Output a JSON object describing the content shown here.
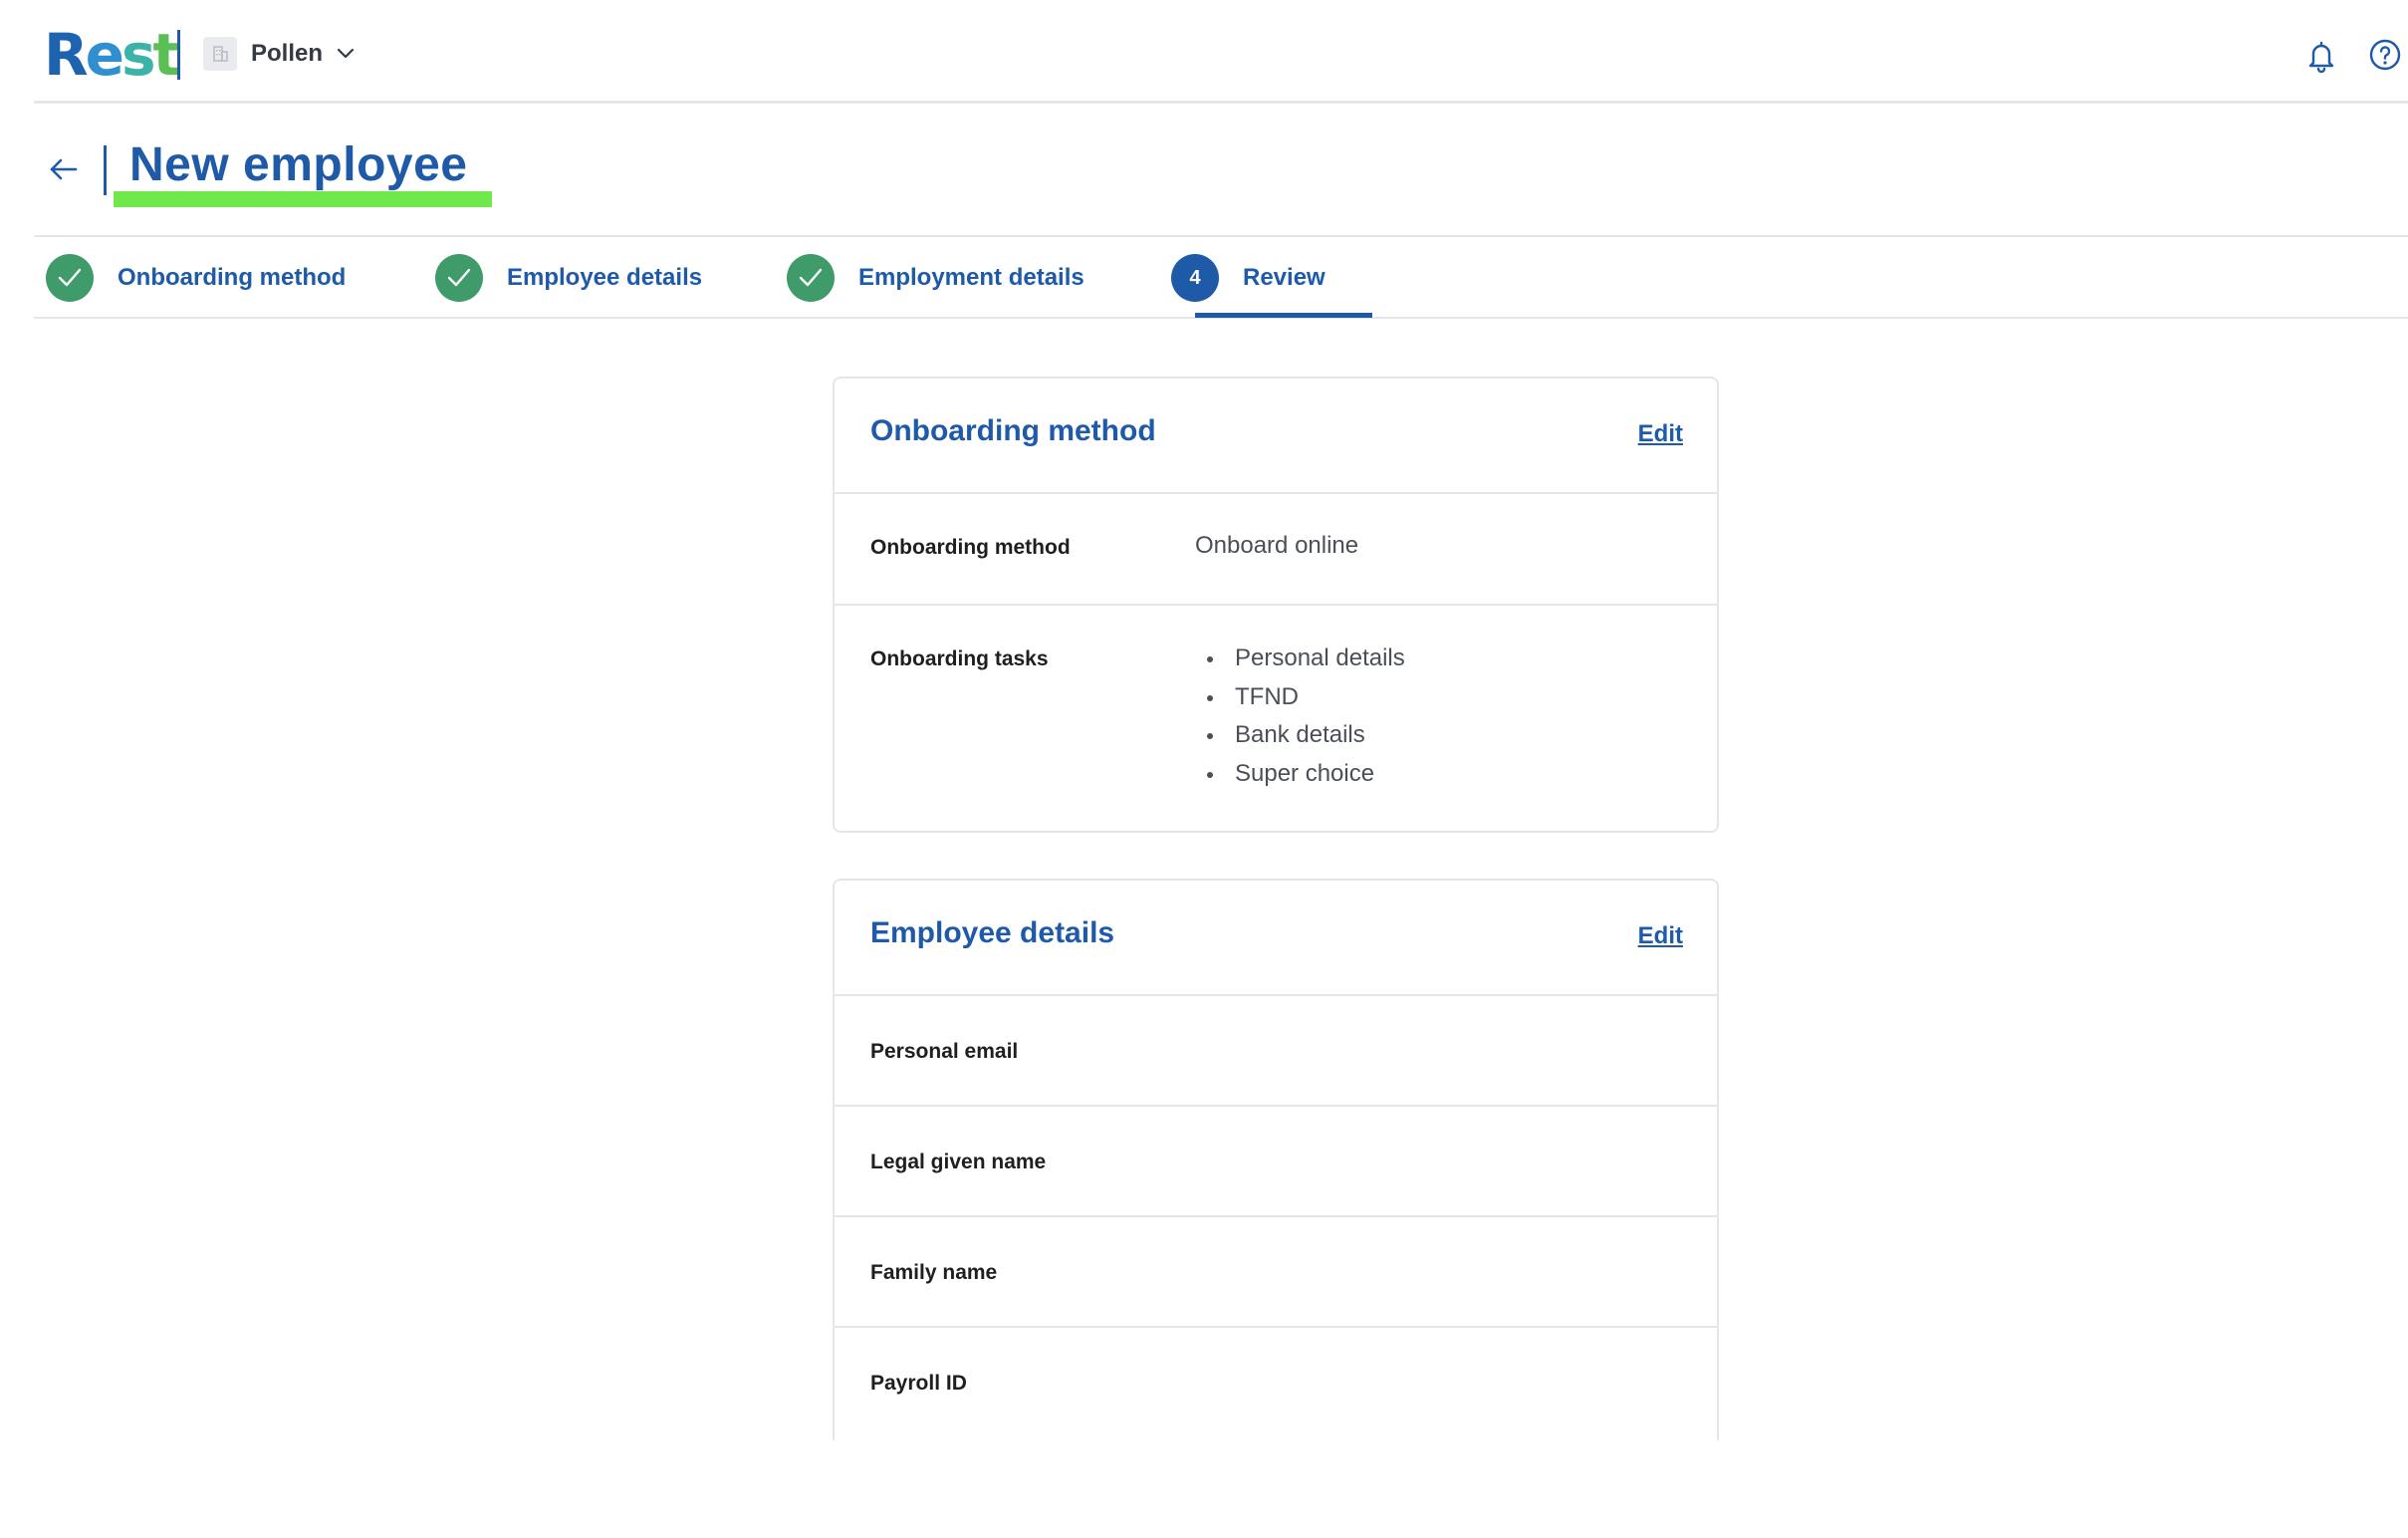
{
  "app": {
    "logo_letters": [
      "R",
      "e",
      "s",
      "t"
    ],
    "org_name": "Pollen"
  },
  "header": {
    "title": "New employee"
  },
  "steps": [
    {
      "label": "Onboarding method",
      "status": "complete"
    },
    {
      "label": "Employee details",
      "status": "complete"
    },
    {
      "label": "Employment details",
      "status": "complete"
    },
    {
      "label": "Review",
      "status": "current",
      "number": "4"
    }
  ],
  "onboarding_card": {
    "title": "Onboarding method",
    "edit_label": "Edit",
    "rows": [
      {
        "label": "Onboarding method",
        "value": "Onboard online"
      },
      {
        "label": "Onboarding tasks",
        "tasks": [
          "Personal details",
          "TFND",
          "Bank details",
          "Super choice"
        ]
      }
    ]
  },
  "employee_card": {
    "title": "Employee details",
    "edit_label": "Edit",
    "rows": [
      {
        "label": "Personal email",
        "value": ""
      },
      {
        "label": "Legal given name",
        "value": ""
      },
      {
        "label": "Family name",
        "value": ""
      },
      {
        "label": "Payroll ID",
        "value": ""
      }
    ]
  },
  "colors": {
    "brand_blue": "#1e5aa8",
    "step_complete": "#3f9b6a",
    "title_highlight": "#6ee84a"
  },
  "icons": {
    "back": "arrow-left-icon",
    "bell": "bell-icon",
    "help": "help-circle-icon",
    "org": "building-icon",
    "chevron": "chevron-down-icon",
    "check": "check-icon"
  }
}
